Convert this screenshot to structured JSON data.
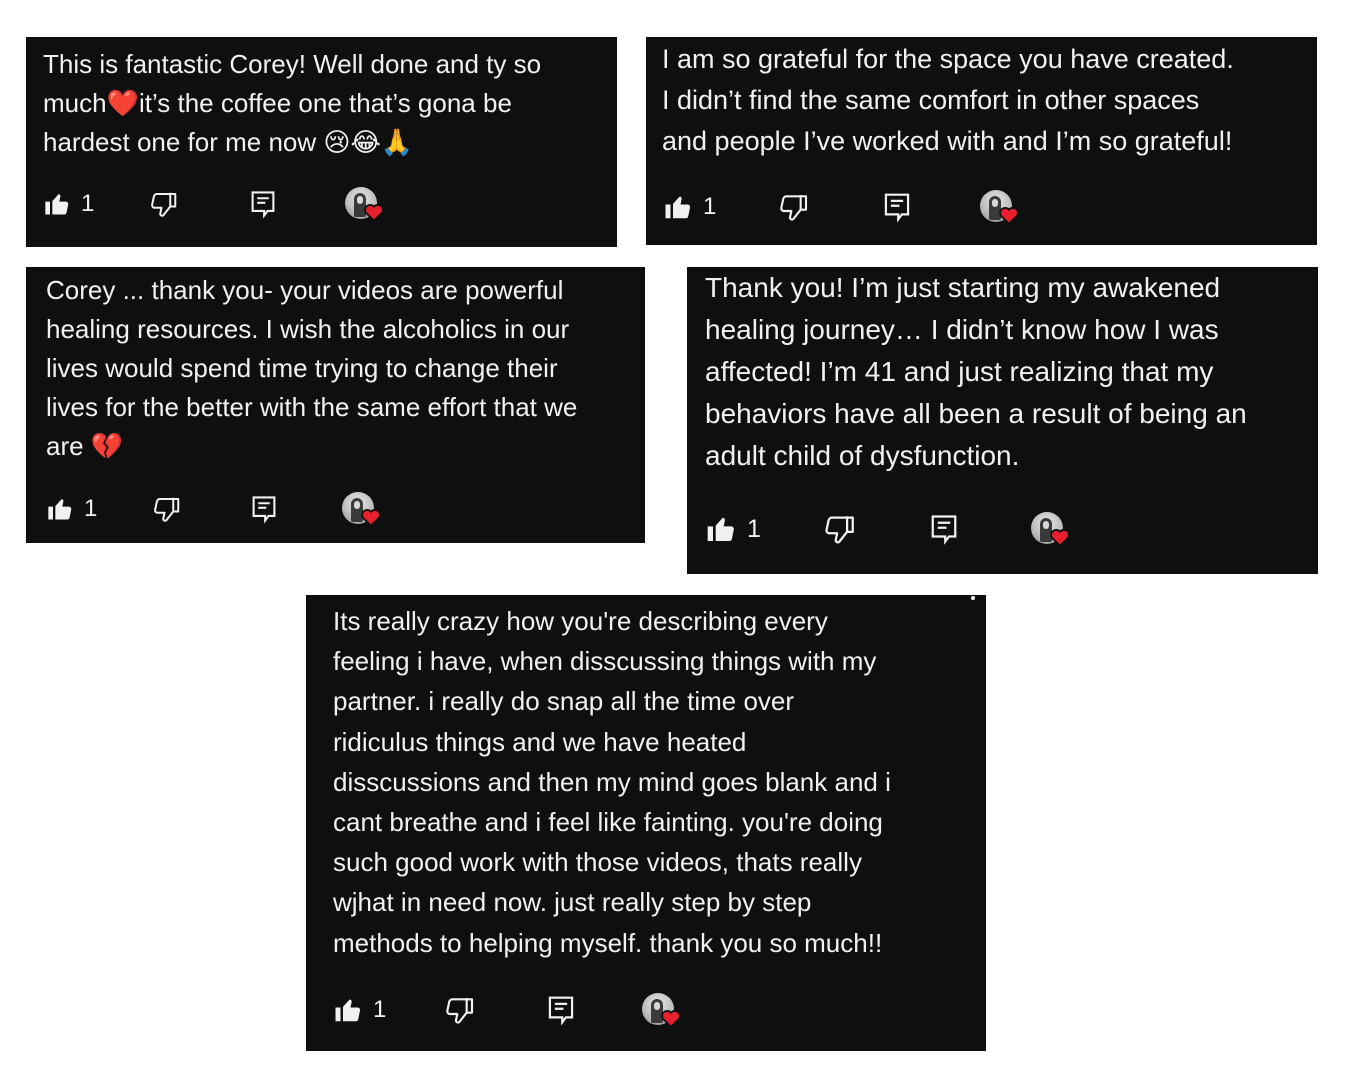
{
  "colors": {
    "card_bg": "#0f0f0f",
    "text": "#f1f1f1",
    "heart": "#e8202d"
  },
  "icons": {
    "like": "thumbs-up-icon",
    "dislike": "thumbs-down-icon",
    "reply": "reply-icon",
    "creator_heart": "creator-heart-avatar"
  },
  "comments": [
    {
      "lines": [
        "This is fantastic Corey! Well done and ty so",
        "much❤️it’s the coffee one that’s gona be",
        "hardest one for me now 😢😂🙏"
      ],
      "likes": "1"
    },
    {
      "lines": [
        "I am so grateful for the space you have created.",
        "I didn’t find the same comfort in other spaces",
        "and people I’ve worked with and I’m so grateful!"
      ],
      "likes": "1"
    },
    {
      "lines": [
        "Corey ... thank you- your videos are powerful",
        "healing resources. I wish the alcoholics in our",
        "lives would spend time trying to change their",
        "lives for the better with the same effort that we",
        "are 💔"
      ],
      "likes": "1"
    },
    {
      "lines": [
        "Thank you!  I’m just starting my awakened",
        "healing journey… I didn’t know how I was",
        "affected!  I’m 41 and just realizing that my",
        "behaviors have all been a result of being an",
        "adult child of dysfunction."
      ],
      "likes": "1"
    },
    {
      "lines": [
        "Its really crazy how you're describing every",
        "feeling i have, when disscussing things with my",
        "partner. i really do snap all the time over",
        "ridiculus things and we have heated",
        "disscussions and then my mind goes blank and i",
        "cant breathe and i feel like fainting. you're doing",
        "such good work with those videos, thats really",
        "wjhat in need now. just really step by step",
        "methods to helping myself. thank you so much!!"
      ],
      "likes": "1"
    }
  ]
}
